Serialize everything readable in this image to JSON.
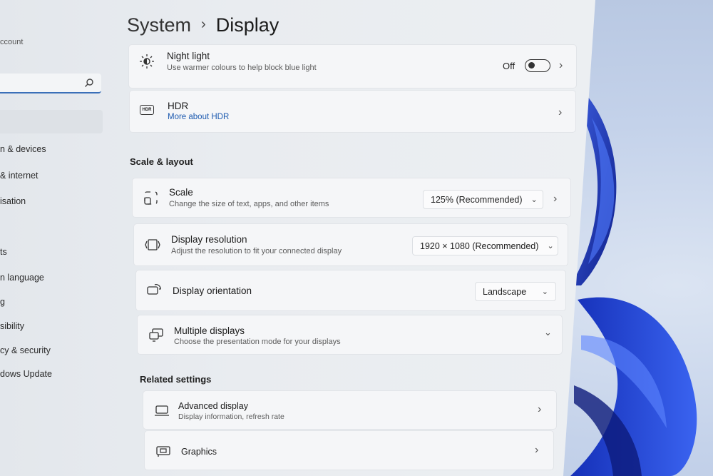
{
  "breadcrumb": {
    "parent": "System",
    "separator": "›",
    "current": "Display"
  },
  "nav": {
    "account_text": "ccount",
    "items": [
      "n & devices",
      "& internet",
      "isation",
      "ts",
      "n language",
      "g",
      "sibility",
      "cy & security",
      "dows Update"
    ]
  },
  "night_light": {
    "title": "Night light",
    "subtitle": "Use warmer colours to help block blue light",
    "state": "Off"
  },
  "hdr": {
    "title": "HDR",
    "link": "More about HDR",
    "icon_text": "HDR"
  },
  "scale_layout": {
    "header": "Scale & layout",
    "scale": {
      "title": "Scale",
      "subtitle": "Change the size of text, apps, and other items",
      "value": "125% (Recommended)"
    },
    "resolution": {
      "title": "Display resolution",
      "subtitle": "Adjust the resolution to fit your connected display",
      "value": "1920 × 1080 (Recommended)"
    },
    "orientation": {
      "title": "Display orientation",
      "value": "Landscape"
    },
    "multiple": {
      "title": "Multiple displays",
      "subtitle": "Choose the presentation mode for your displays"
    }
  },
  "related": {
    "header": "Related settings",
    "advanced": {
      "title": "Advanced display",
      "subtitle": "Display information, refresh rate"
    },
    "graphics": {
      "title": "Graphics"
    }
  },
  "colors": {
    "accent": "#1e5bb0",
    "search_underline": "#3a6fb8",
    "wallpaper_bloom": "#1f3fc8"
  }
}
